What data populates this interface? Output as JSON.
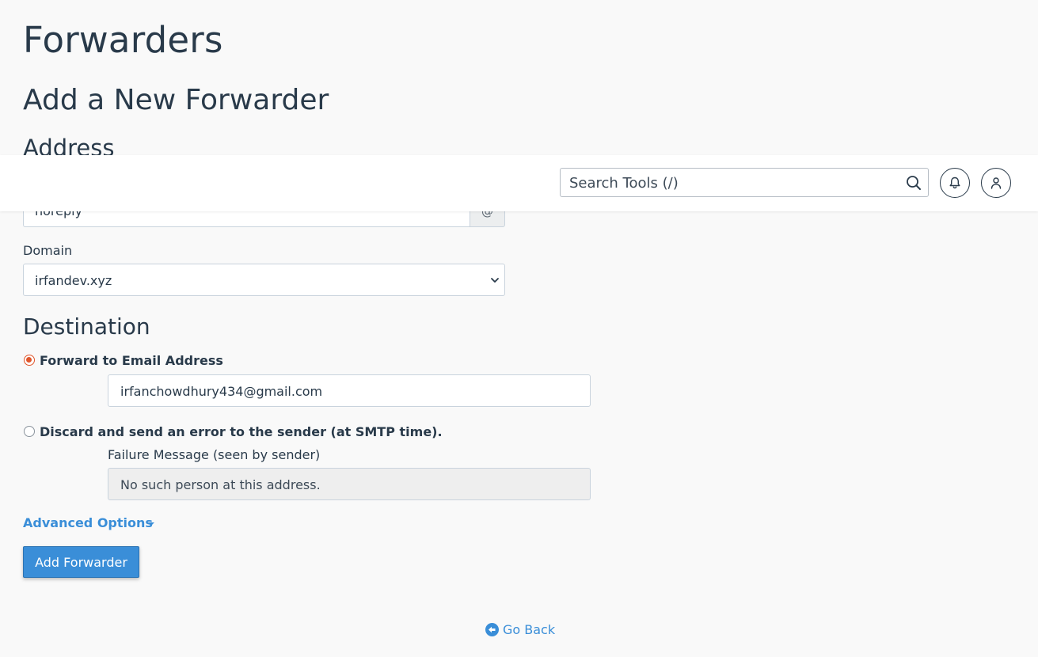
{
  "page": {
    "title": "Forwarders",
    "section_title": "Add a New Forwarder",
    "address_title": "Address"
  },
  "address": {
    "value": "noreply",
    "addon": "@"
  },
  "header": {
    "search_placeholder": "Search Tools (/)",
    "icons": [
      "search-icon",
      "bell-icon",
      "user-icon"
    ]
  },
  "domain": {
    "label": "Domain",
    "selected": "irfandev.xyz"
  },
  "destination": {
    "title": "Destination",
    "forward_label": "Forward to Email Address",
    "forward_value": "irfanchowdhury434@gmail.com",
    "discard_label": "Discard and send an error to the sender (at SMTP time).",
    "failure_label": "Failure Message (seen by sender)",
    "failure_value": "No such person at this address.",
    "selected_option": "forward"
  },
  "actions": {
    "advanced_options": "Advanced Options",
    "add_button": "Add Forwarder",
    "go_back": "Go Back"
  },
  "colors": {
    "accent": "#3a8ed8",
    "radio_checked": "#e0552b",
    "text": "#293a4a"
  }
}
